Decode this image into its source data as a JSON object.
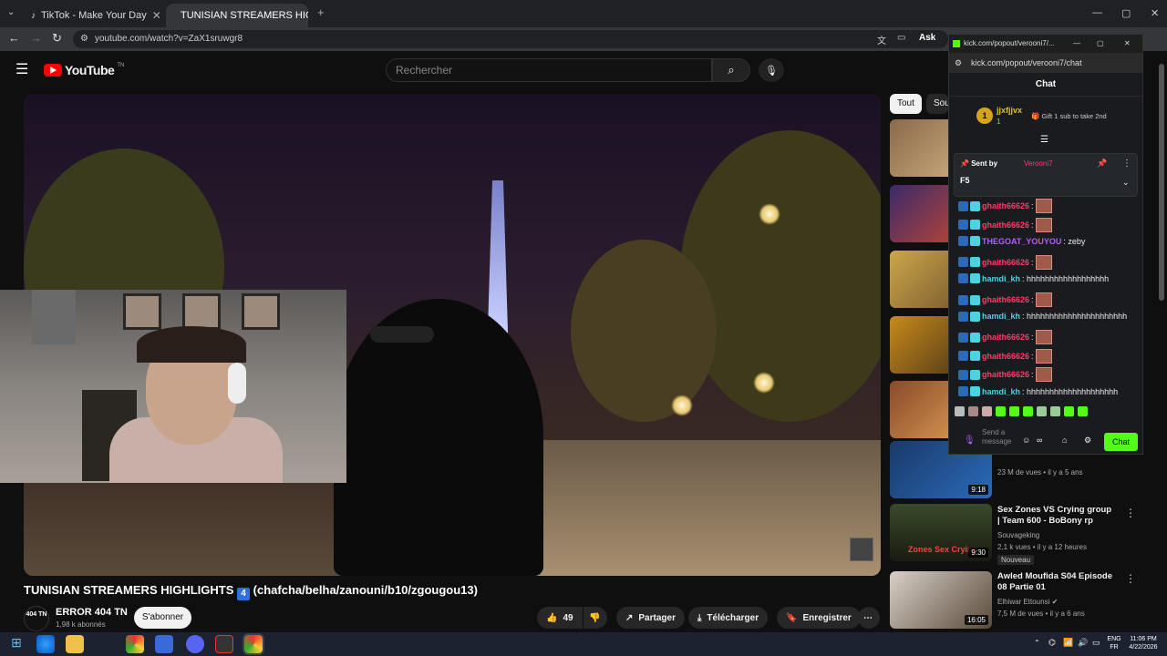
{
  "browser": {
    "tabs": [
      {
        "label": "TikTok - Make Your Day"
      },
      {
        "label": "TUNISIAN STREAMERS HIGH"
      }
    ],
    "url": "youtube.com/watch?v=ZaX1sruwgr8",
    "ask_label": "Ask"
  },
  "youtube": {
    "logo_text": "YouTube",
    "logo_region": "TN",
    "search_placeholder": "Rechercher",
    "video_title": "TUNISIAN STREAMERS HIGHLIGHTS",
    "video_title_badge": "4",
    "video_title_suffix": "(chafcha/belha/zanouni/b10/zgougou13)",
    "channel": {
      "name": "ERROR 404 TN",
      "subscribers": "1,98 k abonnés",
      "avatar_text": "404 TN"
    },
    "subscribe_label": "S'abonner",
    "actions": {
      "likes": "49",
      "share": "Partager",
      "download": "Télécharger",
      "save": "Enregistrer"
    },
    "chips": [
      "Tout",
      "Sou"
    ],
    "recommendations": [
      {
        "title": "",
        "views": "23 M de vues",
        "age": "il y a 5 ans",
        "duration": "9:18"
      },
      {
        "title": "Sex Zones VS Crying group | Team 600 - BoBony rp",
        "channel": "Souvageking",
        "views": "2,1 k vues",
        "age": "il y a 12 heures",
        "badge": "Nouveau",
        "duration": "9:30",
        "thumb_text": "Zones Sex Crying"
      },
      {
        "title": "Awled Moufida S04 Episode 08 Partie 01",
        "channel": "Elhiwar Ettounsi",
        "views": "7,5 M de vues",
        "age": "il y a 6 ans",
        "duration": "16:05"
      }
    ]
  },
  "kick": {
    "window_title": "kick.com/popout/verooni7/...",
    "url": "kick.com/popout/verooni7/chat",
    "header": "Chat",
    "leader": {
      "rank": "1",
      "name": "jjxfjjvx",
      "count": "1"
    },
    "gift_text": "Gift 1 sub to take 2nd",
    "pinned": {
      "sent_by": "Sent by",
      "user": "Verooni7",
      "message": "F5"
    },
    "messages": [
      {
        "user": "ghaith66626",
        "text": ":",
        "color": "#ff3b6b"
      },
      {
        "user": "ghaith66626",
        "text": ":",
        "color": "#ff3b6b"
      },
      {
        "user": "THEGOAT_YOUYOU",
        "text": ": zeby",
        "color": "#b75bff"
      },
      {
        "user": "ghaith66626",
        "text": ":",
        "color": "#ff3b6b"
      },
      {
        "user": "hamdi_kh",
        "text": ": hhhhhhhhhhhhhhhhhh",
        "color": "#4fd2e0"
      },
      {
        "user": "ghaith66626",
        "text": ":",
        "color": "#ff3b6b"
      },
      {
        "user": "hamdi_kh",
        "text": ": hhhhhhhhhhhhhhhhhhhhhh",
        "color": "#4fd2e0"
      },
      {
        "user": "ghaith66626",
        "text": ":",
        "color": "#ff3b6b"
      },
      {
        "user": "ghaith66626",
        "text": ":",
        "color": "#ff3b6b"
      },
      {
        "user": "ghaith66626",
        "text": ":",
        "color": "#ff3b6b"
      },
      {
        "user": "hamdi_kh",
        "text": ": hhhhhhhhhhhhhhhhhhhh",
        "color": "#4fd2e0"
      }
    ],
    "input_placeholder": "Send a message",
    "chat_button": "Chat"
  },
  "taskbar": {
    "lang": "ENG",
    "layout": "FR",
    "time": "11:06 PM",
    "date": "4/22/2026"
  },
  "colors": {
    "accent_green": "#53fc18",
    "youtube_red": "#ff0000"
  }
}
